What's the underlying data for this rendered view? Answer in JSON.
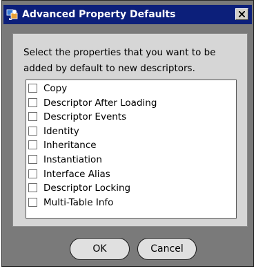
{
  "window": {
    "title": "Advanced Property Defaults",
    "icon": "app-icon",
    "close_icon": "close-icon"
  },
  "instructions": "Select the properties that you want to be added by default to new descriptors.",
  "properties": [
    {
      "label": "Copy",
      "checked": false
    },
    {
      "label": "Descriptor After Loading",
      "checked": false
    },
    {
      "label": "Descriptor Events",
      "checked": false
    },
    {
      "label": "Identity",
      "checked": false
    },
    {
      "label": "Inheritance",
      "checked": false
    },
    {
      "label": "Instantiation",
      "checked": false
    },
    {
      "label": "Interface Alias",
      "checked": false
    },
    {
      "label": "Descriptor Locking",
      "checked": false
    },
    {
      "label": "Multi-Table Info",
      "checked": false
    }
  ],
  "buttons": {
    "ok": "OK",
    "cancel": "Cancel"
  },
  "colors": {
    "titlebar": "#0c1f7a",
    "frame": "#7a7a7a",
    "panel": "#d6d6d6",
    "button": "#e0e0e0"
  }
}
